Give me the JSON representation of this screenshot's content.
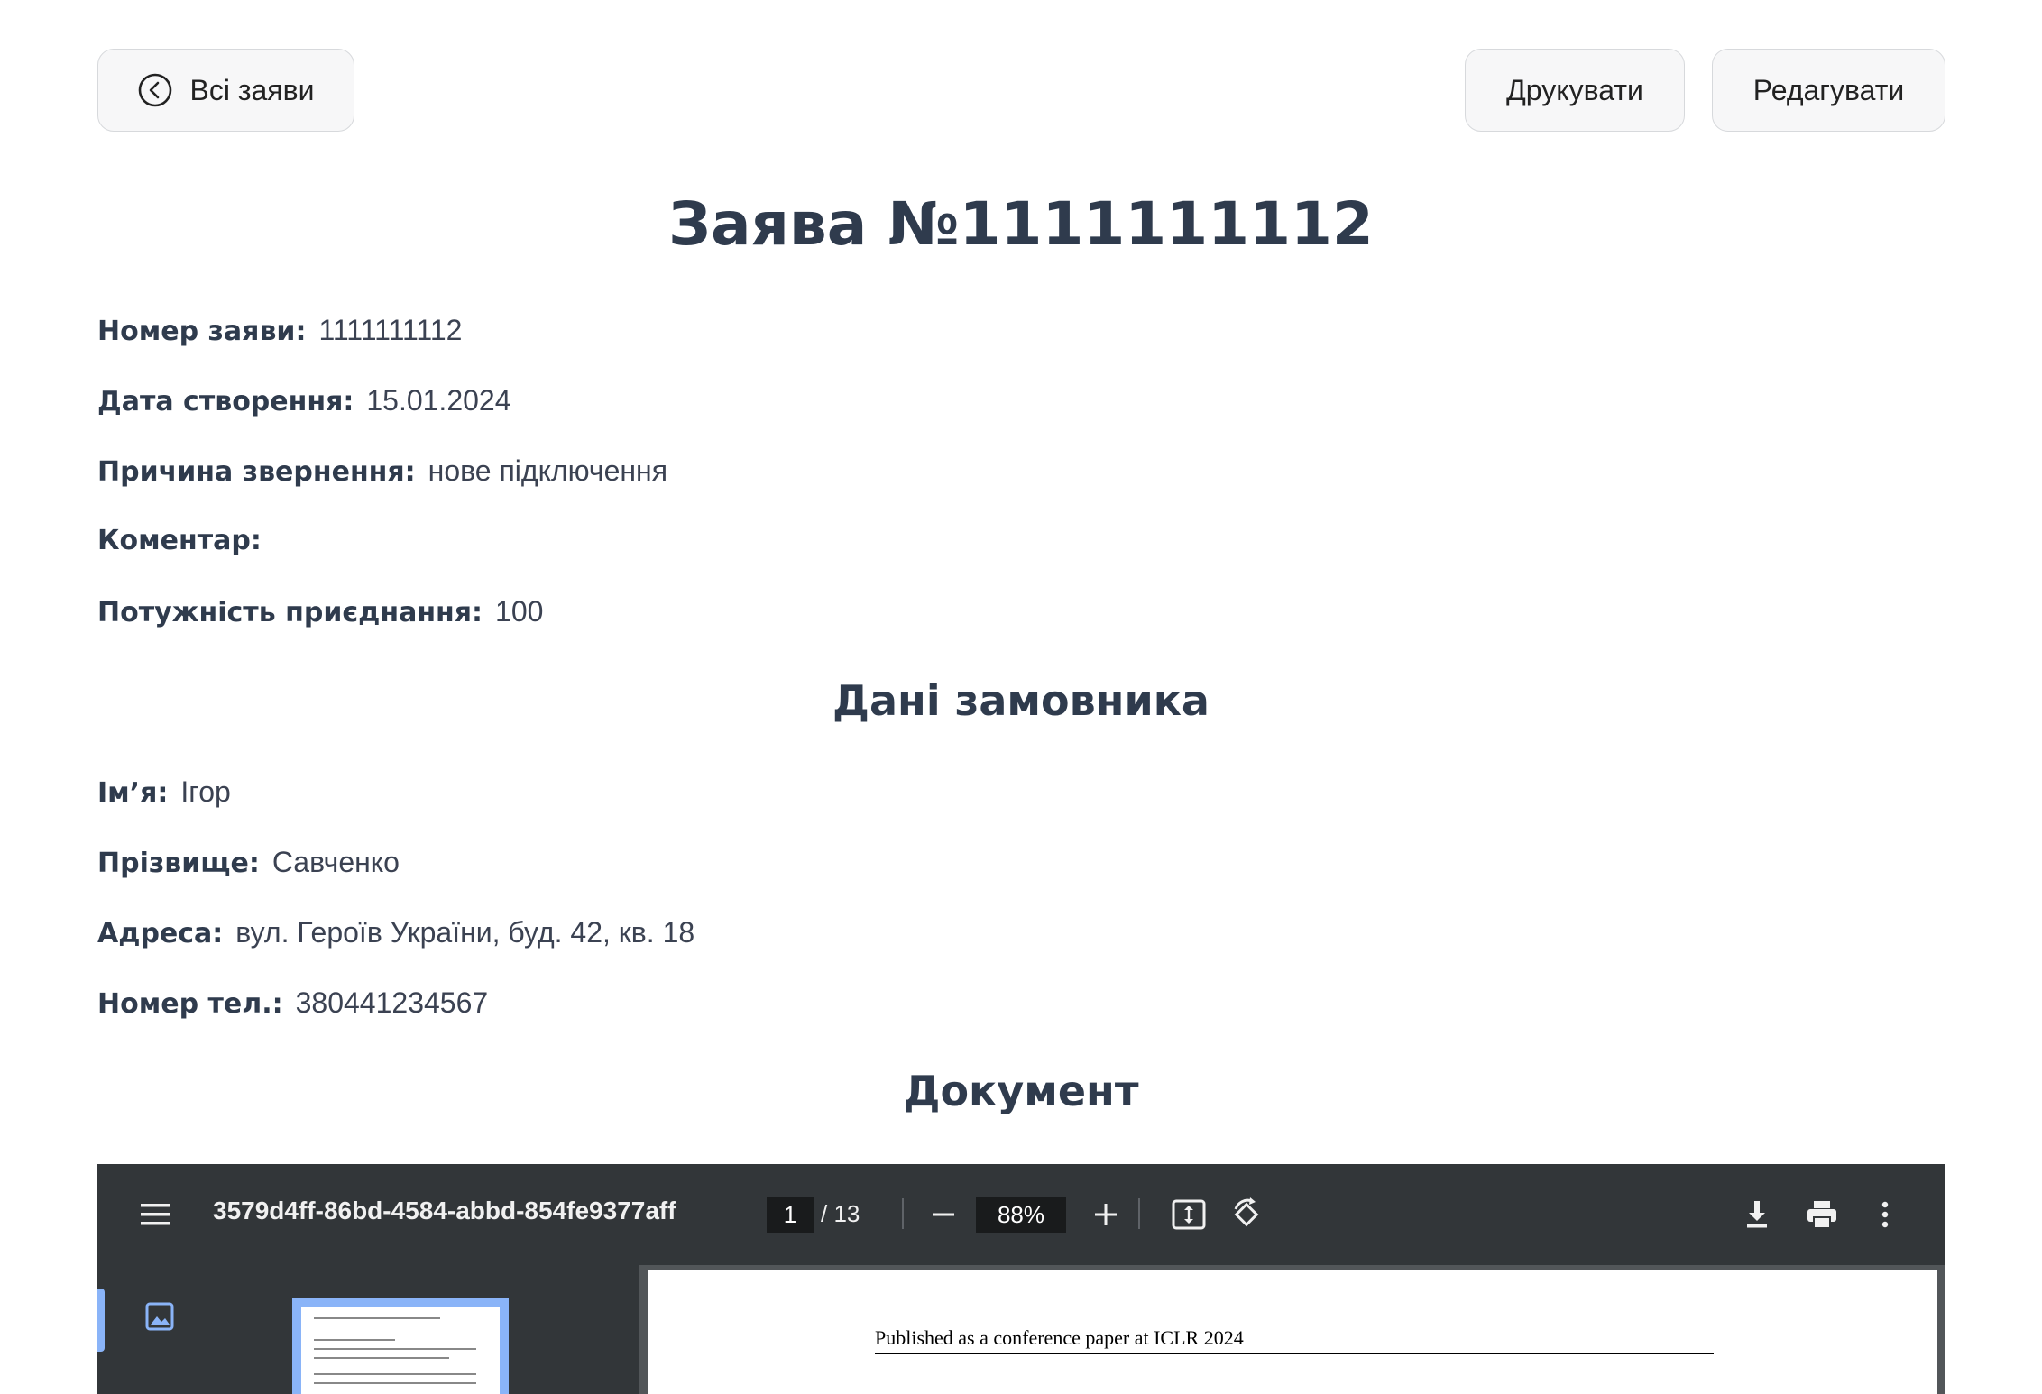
{
  "header": {
    "back_label": "Всі заяви",
    "print_label": "Друкувати",
    "edit_label": "Редагувати"
  },
  "page_title": "Заява №1111111112",
  "application": {
    "number_label": "Номер заяви:",
    "number_value": "1111111112",
    "date_label": "Дата створення:",
    "date_value": "15.01.2024",
    "reason_label": "Причина звернення:",
    "reason_value": "нове підключення",
    "comment_label": "Коментар:",
    "comment_value": "",
    "power_label": "Потужність приєднання:",
    "power_value": "100"
  },
  "customer": {
    "section_title": "Дані замовника",
    "name_label": "Ім’я:",
    "name_value": "Ігор",
    "surname_label": "Прізвище:",
    "surname_value": "Савченко",
    "address_label": "Адреса:",
    "address_value": "вул. Героїв України, буд. 42, кв. 18",
    "phone_label": "Номер тел.:",
    "phone_value": "380441234567"
  },
  "document": {
    "section_title": "Документ",
    "viewer": {
      "file_name": "3579d4ff-86bd-4584-abbd-854fe9377aff",
      "current_page": "1",
      "total_pages": "/ 13",
      "zoom": "88%",
      "page_header": "Published as a conference paper at ICLR 2024"
    }
  },
  "icons": {
    "back": "chevron-left-circle-icon",
    "menu": "hamburger-menu-icon",
    "zoom_out": "minus-icon",
    "zoom_in": "plus-icon",
    "fit": "fit-page-icon",
    "rotate": "rotate-icon",
    "download": "download-icon",
    "print": "printer-icon",
    "more": "more-vertical-icon",
    "thumbnail": "image-icon"
  },
  "colors": {
    "text_dark": "#2f3b4d",
    "viewer_toolbar": "#323639",
    "viewer_bg": "#525659",
    "thumbnail_accent": "#8ab4f8"
  }
}
